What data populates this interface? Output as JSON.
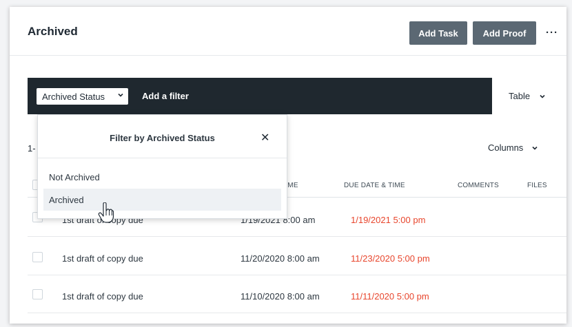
{
  "header": {
    "title": "Archived",
    "add_task_label": "Add Task",
    "add_proof_label": "Add Proof",
    "more_label": "···"
  },
  "filterbar": {
    "status_select_label": "Archived Status",
    "add_filter_label": "Add a filter",
    "view_label": "Table"
  },
  "list": {
    "range_label": "1-",
    "columns_label": "Columns"
  },
  "table": {
    "columns": [
      "TIME",
      "DUE DATE & TIME",
      "COMMENTS",
      "FILES"
    ],
    "rows": [
      {
        "name": "1st draft of copy due",
        "start": "1/19/2021 8:00 am",
        "due": "1/19/2021 5:00 pm"
      },
      {
        "name": "1st draft of copy due",
        "start": "11/20/2020 8:00 am",
        "due": "11/23/2020 5:00 pm"
      },
      {
        "name": "1st draft of copy due",
        "start": "11/10/2020 8:00 am",
        "due": "11/11/2020 5:00 pm"
      }
    ]
  },
  "dropdown": {
    "title": "Filter by Archived Status",
    "options": [
      "Not Archived",
      "Archived"
    ]
  },
  "colors": {
    "button_bg": "#5b6873",
    "filterbar_bg": "#1f282f",
    "due_red": "#e8452c"
  }
}
